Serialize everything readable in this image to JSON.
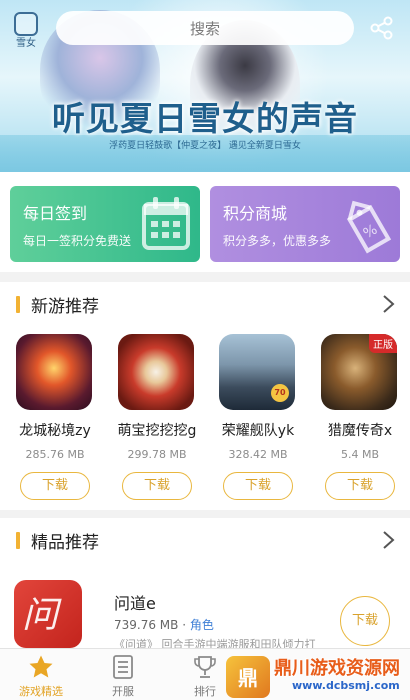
{
  "banner": {
    "logo_text": "雪女",
    "title": "听见夏日雪女的声音",
    "subtitle": "浮药夏日轻鼓歌【仲夏之夜】  遇见全新夏日雪女"
  },
  "search": {
    "placeholder": "搜索"
  },
  "cards": [
    {
      "title": "每日签到",
      "subtitle": "每日一签积分免费送",
      "icon": "calendar-icon"
    },
    {
      "title": "积分商城",
      "subtitle": "积分多多，优惠多多",
      "icon": "price-tag-icon"
    }
  ],
  "new_games": {
    "title": "新游推荐",
    "games": [
      {
        "name": "龙城秘境zy",
        "size": "285.76 MB",
        "download": "下载"
      },
      {
        "name": "萌宝挖挖挖g",
        "size": "299.78 MB",
        "download": "下载"
      },
      {
        "name": "荣耀舰队yk",
        "size": "328.42 MB",
        "download": "下载"
      },
      {
        "name": "猎魔传奇x",
        "size": "5.4 MB",
        "download": "下载",
        "tag": "正版"
      }
    ]
  },
  "featured": {
    "title": "精品推荐",
    "item": {
      "name": "问道e",
      "size": "739.76 MB",
      "separator": "·",
      "category": "角色",
      "description": "《问道》 回合手游中端游服和田队倾力打",
      "download": "下载"
    }
  },
  "nav": [
    {
      "label": "游戏精选",
      "icon": "star-icon",
      "active": true
    },
    {
      "label": "开服",
      "icon": "list-icon",
      "active": false
    },
    {
      "label": "排行",
      "icon": "trophy-icon",
      "active": false
    }
  ],
  "watermark": {
    "logo": "鼎",
    "title": "鼎川游戏资源网",
    "url": "www.dcbsmj.com"
  },
  "colors": {
    "accent": "#e9b73f",
    "green_card": "#3fc090",
    "purple_card": "#a585dc",
    "category": "#3e7fd6"
  }
}
